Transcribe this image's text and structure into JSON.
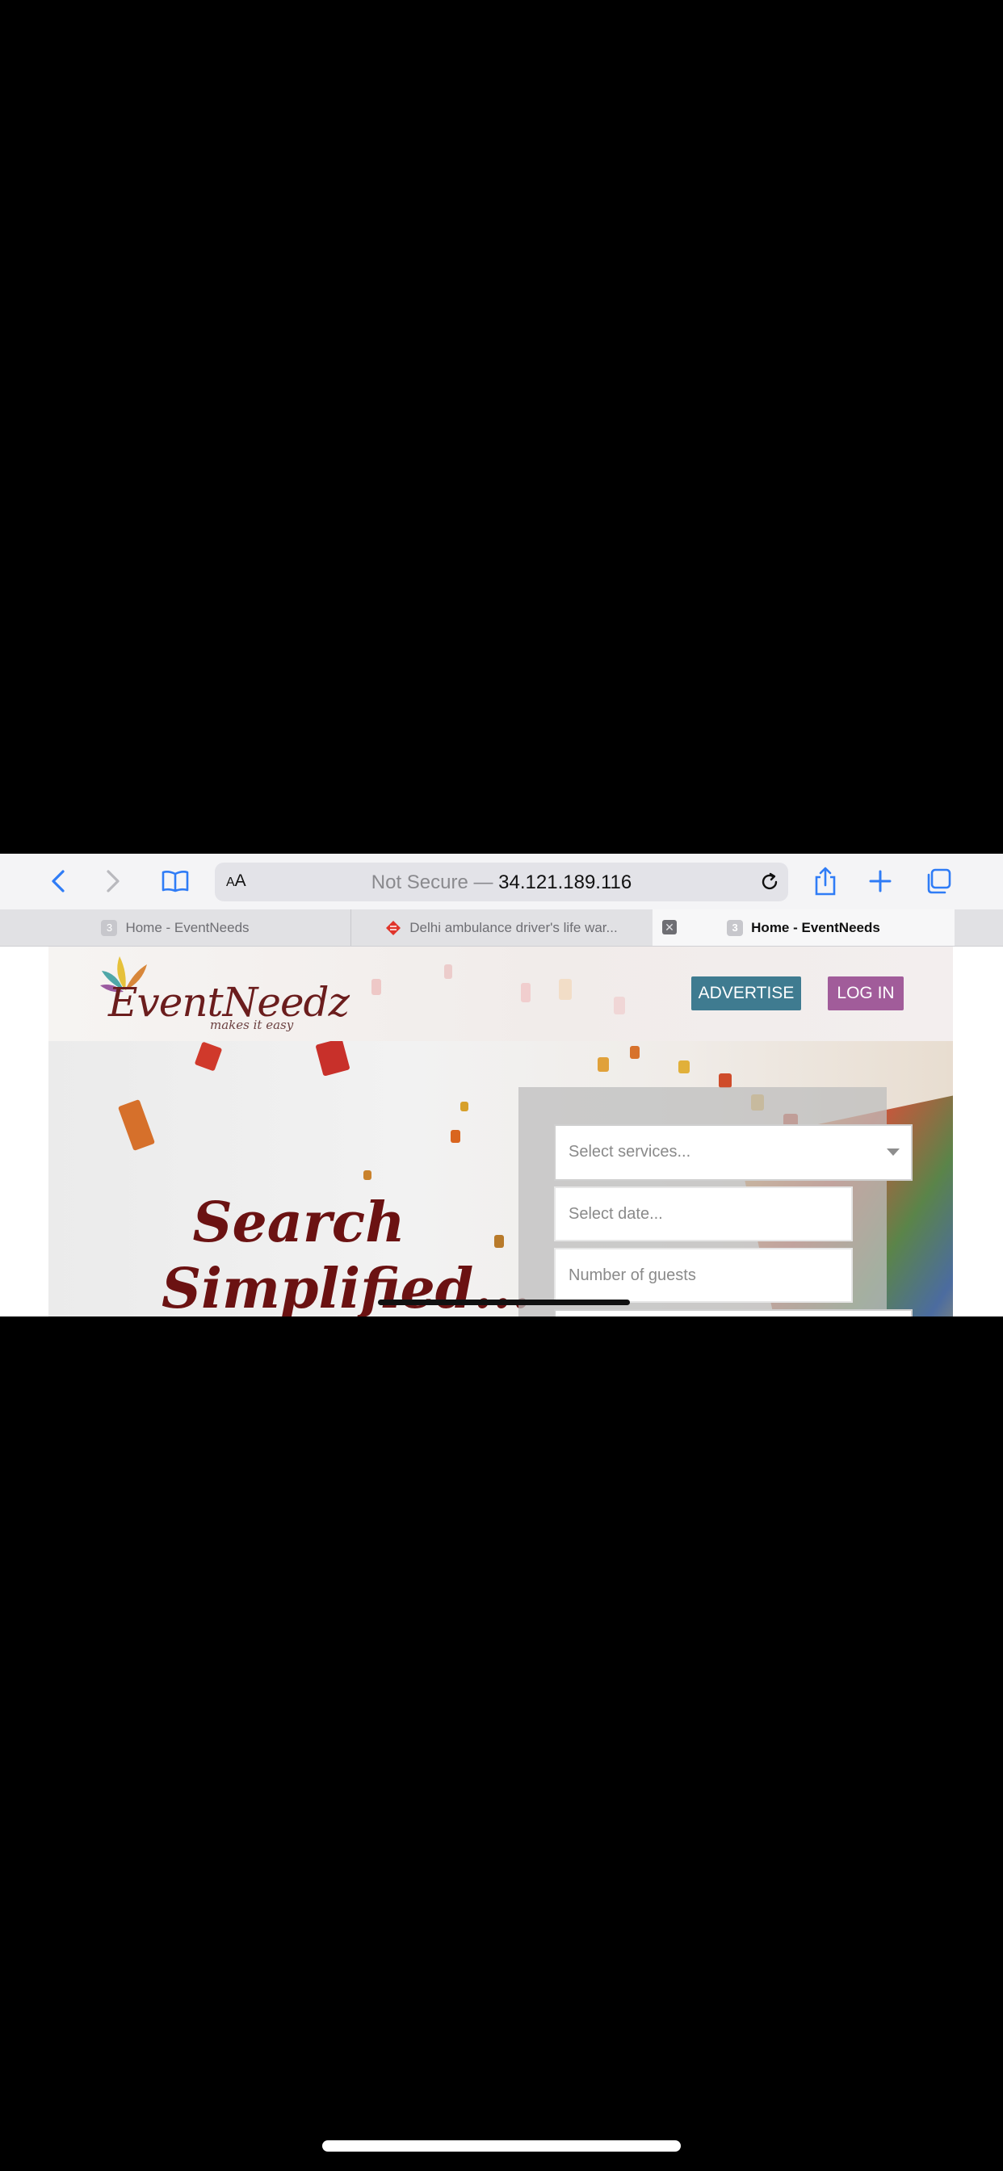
{
  "browser": {
    "reader_label_big": "A",
    "reader_label_small": "A",
    "url_prefix": "Not Secure — ",
    "url_host": "34.121.189.116"
  },
  "tabs": [
    {
      "title": "Home - EventNeeds",
      "favicon": "grey-page-icon",
      "active": false
    },
    {
      "title": "Delhi ambulance driver's life war...",
      "favicon": "red-diamond-logo-icon",
      "active": false
    },
    {
      "title": "Home - EventNeeds",
      "favicon": "grey-page-icon",
      "active": true
    }
  ],
  "site": {
    "logo_text": "EventNeedz",
    "logo_tagline": "makes it easy",
    "advertise_label": "ADVERTISE",
    "login_label": "LOG IN",
    "headline_line1": "Search",
    "headline_line2": "Simplified..."
  },
  "search_form": {
    "services_placeholder": "Select services...",
    "date_placeholder": "Select date...",
    "guests_placeholder": "Number of guests"
  },
  "colors": {
    "advertise_bg": "#3f7b90",
    "login_bg": "#a15c9a",
    "headline": "#6b1212",
    "browser_accent": "#2f7cf6"
  }
}
